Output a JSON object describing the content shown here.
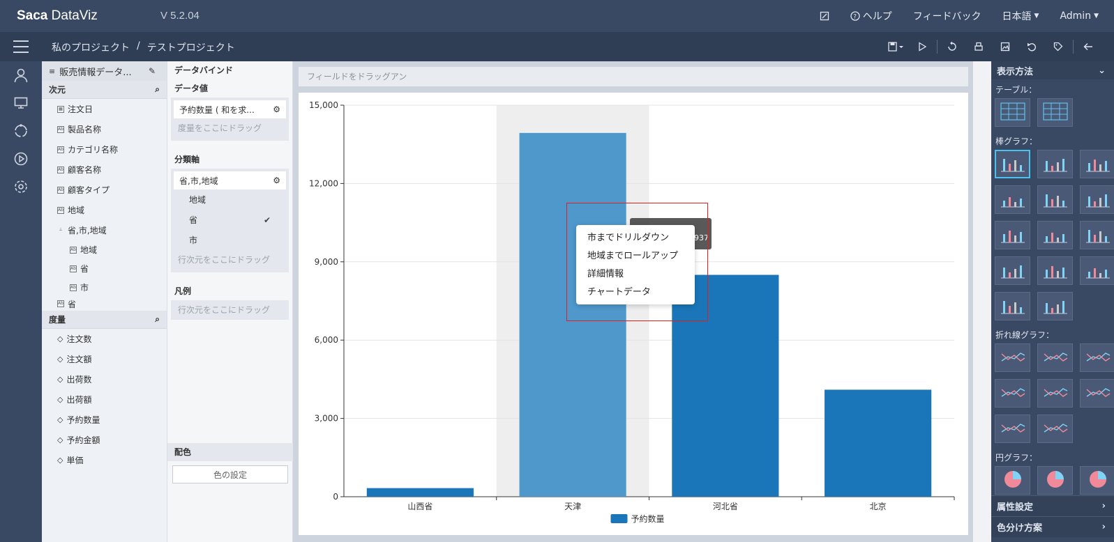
{
  "header": {
    "logo_bold": "Saca",
    "logo_light": " DataViz",
    "version": "V 5.2.04",
    "help": "ヘルプ",
    "feedback": "フィードバック",
    "language": "日本語",
    "user": "Admin"
  },
  "breadcrumb": {
    "root": "私のプロジェクト",
    "sep": "/",
    "current": "テストプロジェクト"
  },
  "fields": {
    "dataset": "販売情報データ...",
    "dimension_title": "次元",
    "dimensions": [
      "注文日",
      "製品名称",
      "カテゴリ名称",
      "顧客名称",
      "顧客タイプ",
      "地域",
      "省,市,地域"
    ],
    "hierarchy": [
      "地域",
      "省",
      "市"
    ],
    "extra_dimension": "省",
    "measure_title": "度量",
    "measures": [
      "注文数",
      "注文額",
      "出荷数",
      "出荷額",
      "予約数量",
      "予約金額",
      "単価"
    ]
  },
  "binding": {
    "title": "データバインド",
    "value_title": "データ値",
    "value_chip": "予約数量 ( 和を求...",
    "value_drop": "度量をここにドラッグ",
    "axis_title": "分類軸",
    "axis_chip": "省,市,地域",
    "axis_options": [
      "地域",
      "省",
      "市"
    ],
    "axis_selected": "省",
    "axis_drop": "行次元をここにドラッグ",
    "legend_title": "凡例",
    "legend_drop": "行次元をここにドラッグ",
    "color_title": "配色",
    "color_button": "色の設定"
  },
  "dropbar": "フィールドをドラッグアン",
  "context_menu": [
    "市までドリルダウン",
    "地域までロールアップ",
    "詳細情報",
    "チャートデータ"
  ],
  "tooltip_value": "937",
  "chart_data": {
    "type": "bar",
    "categories": [
      "山西省",
      "天津",
      "河北省",
      "北京"
    ],
    "series": [
      {
        "name": "予約数量",
        "values": [
          330,
          13937,
          8500,
          4100
        ],
        "color": "#1a76b9"
      }
    ],
    "highlight_index": 1,
    "highlight_color": "#4e98cc",
    "ylim": [
      0,
      15000
    ],
    "yticks": [
      "15,000",
      "12,000",
      "9,000",
      "6,000",
      "3,000",
      "0"
    ],
    "grid": true,
    "legend_position": "bottom"
  },
  "right_panel": {
    "title": "表示方法",
    "table_label": "テーブル：",
    "bar_label": "棒グラフ：",
    "line_label": "折れ線グラフ：",
    "pie_label": "円グラフ：",
    "attr_settings": "属性設定",
    "color_scheme": "色分け方案"
  },
  "colors": {
    "header": "#3a4963",
    "subheader": "#2f3d55",
    "bar": "#1a76b9",
    "accent": "#4bc1f0"
  }
}
